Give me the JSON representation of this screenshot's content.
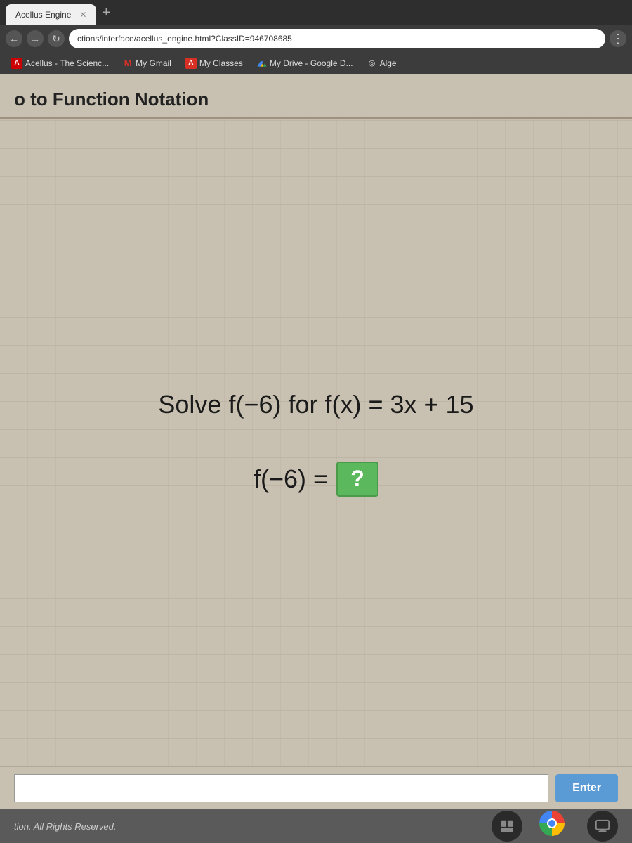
{
  "browser": {
    "tab_title": "Acellus Engine",
    "address_url": "ctions/interface/acellus_engine.html?ClassID=946708685",
    "nav_back": "←",
    "nav_forward": "→",
    "nav_reload": "↻",
    "nav_plus": "+"
  },
  "bookmarks": [
    {
      "id": "acellus",
      "icon": "A",
      "label": "Acellus - The Scienc..."
    },
    {
      "id": "gmail",
      "icon": "M",
      "label": "My Gmail"
    },
    {
      "id": "myclasses",
      "icon": "A",
      "label": "My Classes"
    },
    {
      "id": "mydrive",
      "icon": "◎",
      "label": "My Drive - Google D..."
    },
    {
      "id": "alge",
      "icon": "◎",
      "label": "Alge"
    }
  ],
  "page": {
    "title": "o to Function Notation",
    "math_question": "Solve f(−6) for f(x) = 3x + 15",
    "math_answer_prefix": "f(−6) = ",
    "answer_placeholder": "?",
    "input_placeholder": "",
    "enter_button_label": "Enter"
  },
  "footer": {
    "text": "tion. All Rights Reserved."
  },
  "taskbar": {
    "icon1": "files",
    "icon2": "chrome",
    "icon3": "system"
  }
}
